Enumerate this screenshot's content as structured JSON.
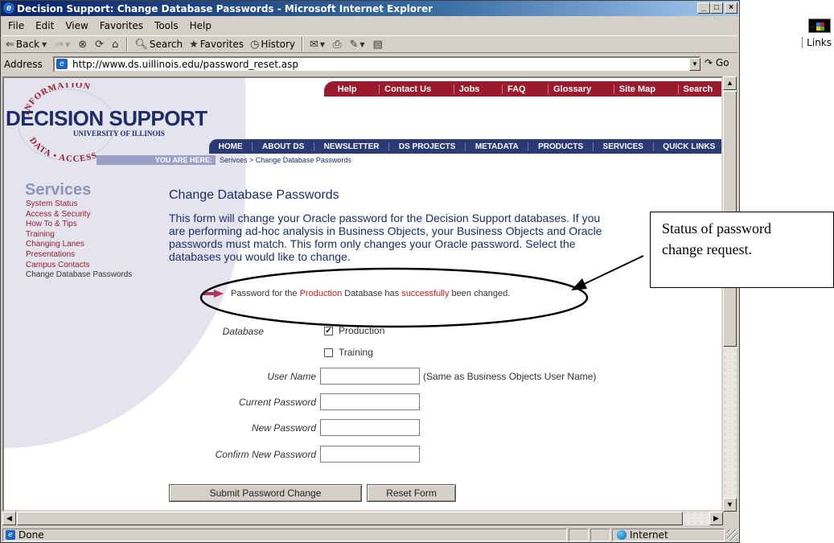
{
  "window": {
    "title": "Decision Support: Change Database Passwords - Microsoft Internet Explorer",
    "minimize": "_",
    "maximize": "□",
    "close": "×"
  },
  "menu": [
    "File",
    "Edit",
    "View",
    "Favorites",
    "Tools",
    "Help"
  ],
  "toolbar": {
    "back": "Back",
    "search": "Search",
    "favorites": "Favorites",
    "history": "History",
    "links": "Links"
  },
  "address": {
    "label": "Address",
    "url": "http://www.ds.uillinois.edu/password_reset.asp",
    "go": "Go"
  },
  "site": {
    "top_nav": [
      "Help",
      "Contact Us",
      "Jobs",
      "FAQ",
      "Glossary",
      "Site Map",
      "Search"
    ],
    "main_nav": [
      "HOME",
      "ABOUT DS",
      "NEWSLETTER",
      "DS PROJECTS",
      "METADATA",
      "PRODUCTS",
      "SERVICES",
      "QUICK LINKS"
    ],
    "logo_title": "DECISION SUPPORT",
    "logo_univ": "UNIVERSITY OF ILLINOIS",
    "seal_top": "INFORMATION",
    "seal_bottom": "DATA • ACCESS",
    "you_are_here": "YOU ARE HERE:",
    "breadcrumb": "Serivces > Change Database Passwords",
    "section": "Services",
    "side_links": [
      "System Status",
      "Access & Security",
      "How To & Tips",
      "Training",
      "Changing Lanes",
      "Presentations",
      "Campus Contacts",
      "Change Database Passwords"
    ]
  },
  "page": {
    "heading": "Change Database Passwords",
    "intro_lines": [
      "This form will change your Oracle password for the Decision Support databases.  If you",
      "are performing ad-hoc analysis in Business Objects, your Business Objects and Oracle",
      "passwords must match.  This form only changes your Oracle password.  Select the",
      "databases you would like to change."
    ],
    "message": {
      "part1": "Password for the ",
      "db": "Production",
      "part2": " Database has ",
      "status": "successfully",
      "part3": " been changed."
    }
  },
  "form": {
    "database_label": "Database",
    "production_label": "Production",
    "production_checked": true,
    "training_label": "Training",
    "training_checked": false,
    "username_label": "User Name",
    "username_hint": "(Same as  Business Objects User Name)",
    "current_label": "Current Password",
    "new_label": "New Password",
    "confirm_label": "Confirm New Password",
    "submit": "Submit Password Change",
    "reset": "Reset Form"
  },
  "status_bar": {
    "text": "Done",
    "zone": "Internet"
  },
  "annotation": {
    "callout_line1": "Status of password",
    "callout_line2": "change request."
  },
  "colors": {
    "site_red": "#9b1b2e",
    "site_navy": "#2b3a75",
    "status_red": "#d21a1a",
    "title_bar": "#0a246a"
  }
}
